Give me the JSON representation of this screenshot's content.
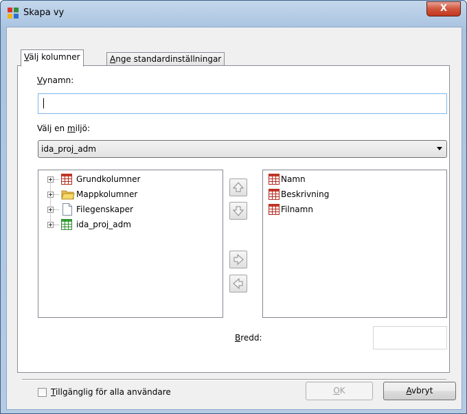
{
  "window": {
    "title": "Skapa vy",
    "close_label": "X"
  },
  "tabs": [
    {
      "label": "Välj kolumner",
      "accel": "V",
      "rest": "älj kolumner"
    },
    {
      "label": "Ange standardinställningar",
      "accel": "A",
      "rest": "nge standardinställningar"
    }
  ],
  "view_name": {
    "label_accel": "V",
    "label_rest": "ynamn:",
    "value": ""
  },
  "environment": {
    "label_pre": "Välj en ",
    "label_accel": "m",
    "label_rest": "iljö:",
    "selected": "ida_proj_adm"
  },
  "available_columns": [
    {
      "label": "Grundkolumner",
      "icon": "table-icon"
    },
    {
      "label": "Mappkolumner",
      "icon": "folder-icon"
    },
    {
      "label": "Filegenskaper",
      "icon": "file-icon"
    },
    {
      "label": "ida_proj_adm",
      "icon": "green-table-icon"
    }
  ],
  "selected_columns": [
    {
      "label": "Namn",
      "icon": "table-icon"
    },
    {
      "label": "Beskrivning",
      "icon": "table-icon"
    },
    {
      "label": "Filnamn",
      "icon": "table-icon"
    }
  ],
  "width": {
    "label_accel": "B",
    "label_rest": "redd:",
    "value": ""
  },
  "footer": {
    "available_all_accel": "T",
    "available_all_rest": "illgänglig för alla användare",
    "ok_accel": "O",
    "ok_rest": "K",
    "cancel_accel": "A",
    "cancel_rest": "vbryt"
  }
}
